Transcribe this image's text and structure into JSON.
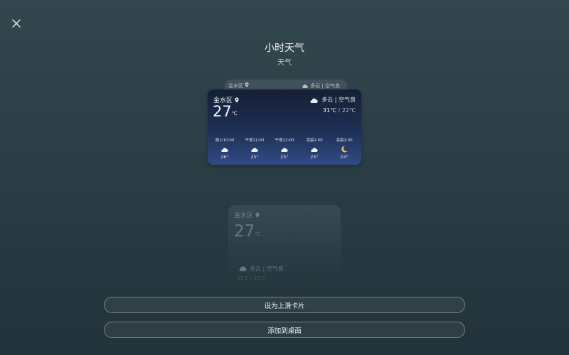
{
  "header": {
    "close_icon": "close-icon",
    "title": "小时天气",
    "subtitle": "天气"
  },
  "back_card": {
    "location": "金水区",
    "condition": "多云 | 空气良"
  },
  "widget": {
    "location": "金水区",
    "temperature": "27",
    "unit": "℃",
    "condition": "多云 | 空气良",
    "high": "31℃",
    "separator": " / ",
    "low": "22℃",
    "hours": [
      {
        "time": "晚上10:00",
        "icon": "partly-cloudy-night-icon",
        "temp": "26°"
      },
      {
        "time": "午夜11:00",
        "icon": "partly-cloudy-night-icon",
        "temp": "25°"
      },
      {
        "time": "午夜12:00",
        "icon": "partly-cloudy-night-icon",
        "temp": "25°"
      },
      {
        "time": "凌晨1:00",
        "icon": "partly-cloudy-night-icon",
        "temp": "25°"
      },
      {
        "time": "凌晨2:00",
        "icon": "moon-icon",
        "temp": "24°"
      }
    ]
  },
  "ghost_card": {
    "location": "金水区",
    "temperature": "27",
    "unit": "℃",
    "condition": "多云 | 空气良",
    "hilo": "31℃ / 22℃"
  },
  "actions": {
    "set_swipe_card": "设为上滑卡片",
    "add_to_desktop": "添加到桌面"
  }
}
